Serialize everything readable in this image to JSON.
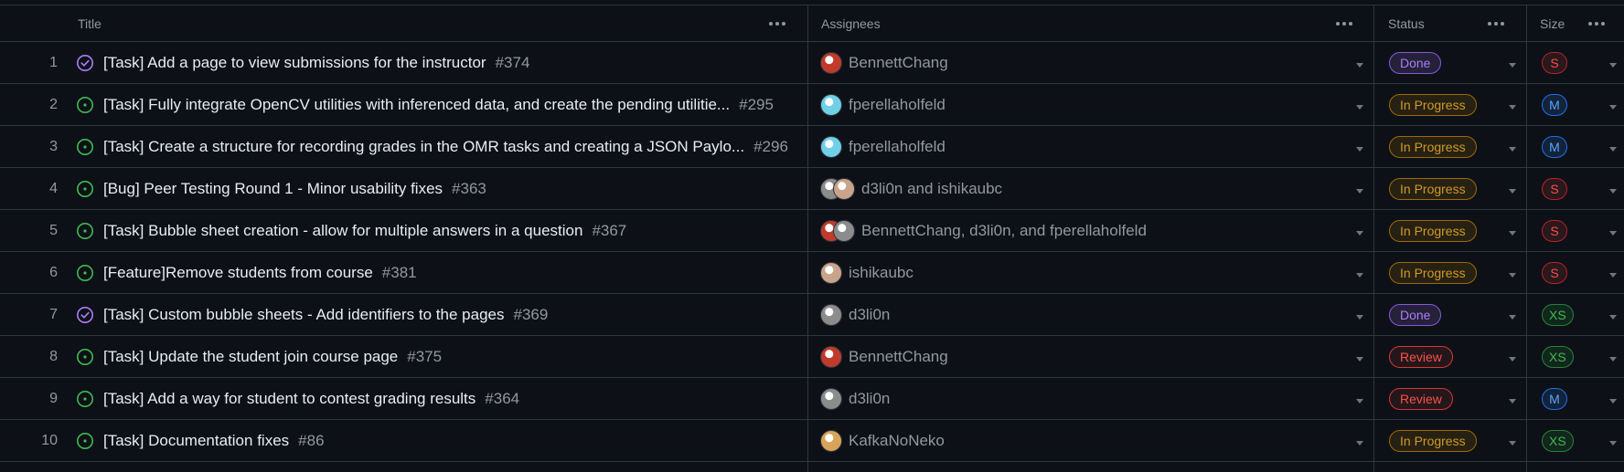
{
  "header": {
    "title_col": "Title",
    "assignees_col": "Assignees",
    "status_col": "Status",
    "size_col": "Size",
    "options_icon": "kebab-horizontal-icon"
  },
  "icons": {
    "open": "issue-opened-icon",
    "closed": "issue-closed-icon",
    "menu": "triangle-down-icon"
  },
  "colors": {
    "open_state": "#3fb950",
    "closed_state": "#ab7df8",
    "status": {
      "Done": {
        "fg": "#ab7df8",
        "bg": "rgba(171,125,248,0.15)",
        "border": "#8957e5"
      },
      "In Progress": {
        "fg": "#d29922",
        "bg": "rgba(187,128,9,0.15)",
        "border": "#9e6a03"
      },
      "Review": {
        "fg": "#f85149",
        "bg": "rgba(248,81,73,0.10)",
        "border": "#da3633"
      }
    },
    "size": {
      "S": {
        "fg": "#f85149",
        "bg": "rgba(248,81,73,0.12)",
        "border": "#b62324"
      },
      "M": {
        "fg": "#58a6ff",
        "bg": "rgba(56,139,253,0.15)",
        "border": "#1f6feb"
      },
      "XS": {
        "fg": "#3fb950",
        "bg": "rgba(46,160,67,0.15)",
        "border": "#238636"
      }
    },
    "avatars": {
      "BennettChang": "#c23a2b",
      "fperellaholfeld": "#6fd0e8",
      "d3li0n": "#8c8c8c",
      "ishikaubc": "#c9a38a",
      "KafkaNoNeko": "#d9a45a"
    }
  },
  "rows": [
    {
      "num": "1",
      "state": "closed",
      "title": "[Task] Add a page to view submissions for the instructor",
      "issue": "#374",
      "avatars": [
        "BennettChang"
      ],
      "assignees": "BennettChang",
      "status": "Done",
      "size": "S"
    },
    {
      "num": "2",
      "state": "open",
      "title": "[Task] Fully integrate OpenCV utilities with inferenced data, and create the pending utilitie...",
      "issue": "#295",
      "avatars": [
        "fperellaholfeld"
      ],
      "assignees": "fperellaholfeld",
      "status": "In Progress",
      "size": "M"
    },
    {
      "num": "3",
      "state": "open",
      "title": "[Task] Create a structure for recording grades in the OMR tasks and creating a JSON Paylo...",
      "issue": "#296",
      "avatars": [
        "fperellaholfeld"
      ],
      "assignees": "fperellaholfeld",
      "status": "In Progress",
      "size": "M"
    },
    {
      "num": "4",
      "state": "open",
      "title": "[Bug] Peer Testing Round 1 - Minor usability fixes",
      "issue": "#363",
      "avatars": [
        "d3li0n",
        "ishikaubc"
      ],
      "assignees": "d3li0n and ishikaubc",
      "status": "In Progress",
      "size": "S"
    },
    {
      "num": "5",
      "state": "open",
      "title": "[Task] Bubble sheet creation - allow for multiple answers in a question",
      "issue": "#367",
      "avatars": [
        "BennettChang",
        "d3li0n"
      ],
      "assignees": "BennettChang, d3li0n, and fperellaholfeld",
      "status": "In Progress",
      "size": "S"
    },
    {
      "num": "6",
      "state": "open",
      "title": "[Feature]Remove students from course",
      "issue": "#381",
      "avatars": [
        "ishikaubc"
      ],
      "assignees": "ishikaubc",
      "status": "In Progress",
      "size": "S"
    },
    {
      "num": "7",
      "state": "closed",
      "title": "[Task] Custom bubble sheets - Add identifiers to the pages",
      "issue": "#369",
      "avatars": [
        "d3li0n"
      ],
      "assignees": "d3li0n",
      "status": "Done",
      "size": "XS"
    },
    {
      "num": "8",
      "state": "open",
      "title": "[Task] Update the student join course page",
      "issue": "#375",
      "avatars": [
        "BennettChang"
      ],
      "assignees": "BennettChang",
      "status": "Review",
      "size": "XS"
    },
    {
      "num": "9",
      "state": "open",
      "title": "[Task] Add a way for student to contest grading results",
      "issue": "#364",
      "avatars": [
        "d3li0n"
      ],
      "assignees": "d3li0n",
      "status": "Review",
      "size": "M"
    },
    {
      "num": "10",
      "state": "open",
      "title": "[Task] Documentation fixes",
      "issue": "#86",
      "avatars": [
        "KafkaNoNeko"
      ],
      "assignees": "KafkaNoNeko",
      "status": "In Progress",
      "size": "XS"
    }
  ]
}
